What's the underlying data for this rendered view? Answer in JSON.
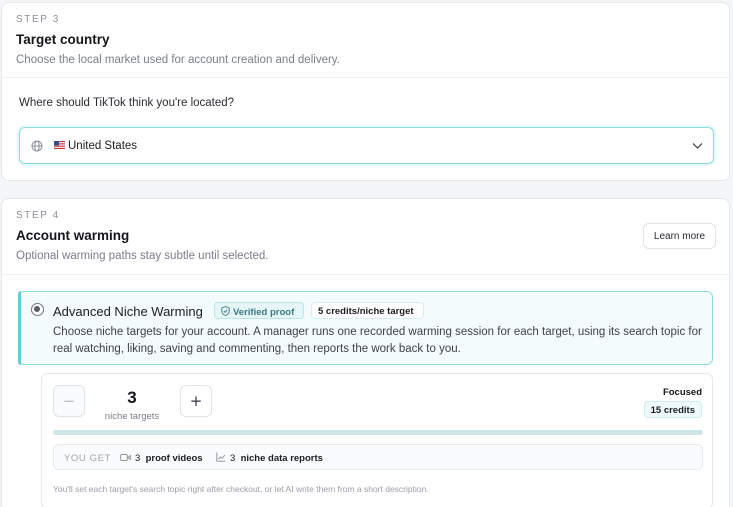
{
  "step3": {
    "step_label": "STEP 3",
    "title": "Target country",
    "description": "Choose the local market used for account creation and delivery.",
    "question": "Where should TikTok think you're located?",
    "country_select": {
      "value": "United States",
      "globe_icon": "globe-icon",
      "flag_icon": "us-flag-icon",
      "chevron_icon": "chevron-down-icon"
    }
  },
  "step4": {
    "step_label": "STEP 4",
    "title": "Account warming",
    "description": "Optional warming paths stay subtle until selected.",
    "learn_more_label": "Learn more",
    "option": {
      "selected": true,
      "title": "Advanced Niche Warming",
      "verified_badge": "Verified proof",
      "credits_badge": "5 credits/niche target",
      "description": "Choose niche targets for your account. A manager runs one recorded warming session for each target, using its search topic for real watching, liking, saving and commenting, then reports the work back to you."
    },
    "stepper": {
      "minus_label": "−",
      "plus_label": "+",
      "count": "3",
      "count_label": "niche targets"
    },
    "tier": {
      "label": "Focused",
      "credits": "15 credits"
    },
    "tier_progress_percent": 100,
    "you_get": {
      "label": "YOU GET",
      "proof_videos_count": "3",
      "proof_videos_label": "proof videos",
      "reports_count": "3",
      "reports_label": "niche data reports"
    },
    "footnote": "You'll set each target's search topic right after checkout, or let AI write them from a short description."
  },
  "colors": {
    "accent": "#5fd0d5",
    "accent_border": "#8fdde0",
    "option_bg": "#f3fbfc"
  }
}
